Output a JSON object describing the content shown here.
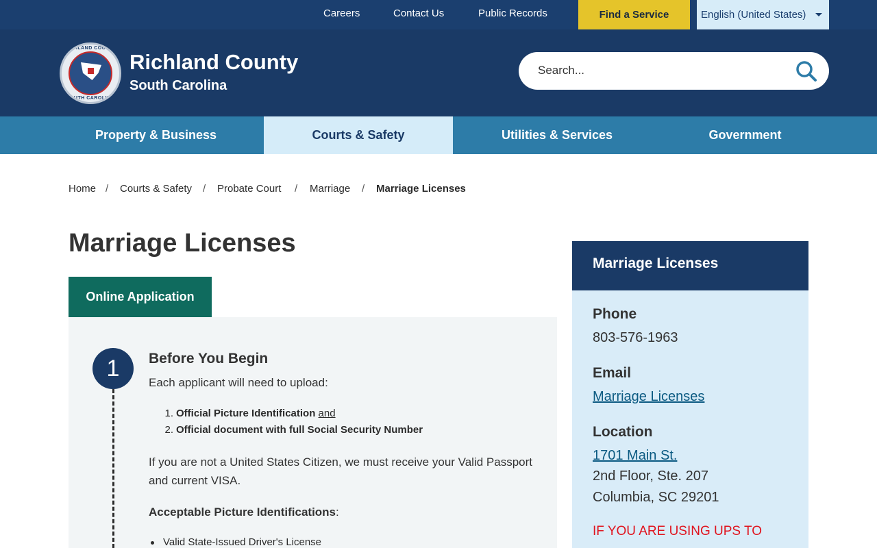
{
  "utility_bar": {
    "links": [
      "Careers",
      "Contact Us",
      "Public Records"
    ],
    "find_service": "Find a Service",
    "language": "English (United States)"
  },
  "header": {
    "seal_top": "RICHLAND COUNTY",
    "seal_bottom": "SOUTH CAROLINA",
    "title": "Richland County",
    "subtitle": "South Carolina",
    "search_placeholder": "Search..."
  },
  "nav": {
    "items": [
      "Property & Business",
      "Courts & Safety",
      "Utilities & Services",
      "Government"
    ],
    "active_index": 1
  },
  "breadcrumb": {
    "items": [
      "Home",
      "Courts & Safety",
      "Probate Court",
      "Marriage",
      "Marriage Licenses"
    ],
    "separator": "/"
  },
  "main": {
    "title": "Marriage Licenses",
    "tab_label": "Online Application",
    "step": {
      "number": "1",
      "heading": "Before You Begin",
      "intro": "Each applicant will need to upload:",
      "requirements": [
        {
          "num": "1.",
          "text": "Official Picture Identification",
          "suffix": "and"
        },
        {
          "num": "2.",
          "text": "Official document with full Social Security Number",
          "suffix": ""
        }
      ],
      "citizen_note": "If you are not a United States Citizen, we must receive your Valid Passport and current VISA.",
      "ids_label": "Acceptable Picture Identifications",
      "ids_colon": ":",
      "ids": [
        "Valid State-Issued Driver's License"
      ]
    }
  },
  "sidebar": {
    "title": "Marriage Licenses",
    "phone_label": "Phone",
    "phone": "803-576-1963",
    "email_label": "Email",
    "email_link": "Marriage Licenses",
    "location_label": "Location",
    "address_link": "1701 Main St.",
    "address_line2": "2nd Floor, Ste. 207",
    "address_line3": "Columbia, SC 29201",
    "warning": "IF YOU ARE USING UPS TO"
  },
  "colors": {
    "utility_bg": "#1b3f6f",
    "header_bg": "#1a3a66",
    "nav_bg": "#2d7ca8",
    "nav_active_bg": "#d5ecf9",
    "find_service_bg": "#e5c42a",
    "tab_bg": "#0f6b5e",
    "sidebar_body_bg": "#d9ecf8",
    "warning": "#e0141e"
  },
  "icons": {
    "search": "search-icon",
    "language_dropdown": "chevron-down-icon",
    "seal": "county-seal-icon"
  }
}
